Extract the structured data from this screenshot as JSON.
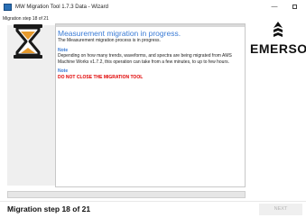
{
  "window": {
    "title": "MW Migration Tool 1.7.3 Data - Wizard",
    "minimize_glyph": "—",
    "app_icon": "window-app-icon"
  },
  "header": {
    "step_text": "Migration step 18 of 21"
  },
  "content": {
    "heading": "Measurement migration in progress.",
    "intro": "The Measurement migration process is in progress.",
    "note1_label": "Note",
    "note1_text": "Depending on how many trends, waveforms, and spectra are being migrated from AMS Machine Works v1.7.2, this operation can take from a few minutes, to up to few hours.",
    "note2_label": "Note",
    "warning": "DO NOT CLOSE THE MIGRATION TOOL"
  },
  "logo": {
    "text": "EMERSON",
    "icon": "emerson-logo-mark"
  },
  "left_panel": {
    "icon": "hourglass-icon",
    "icon_color": "#1a1a1a",
    "sand_color": "#e69a2e"
  },
  "progress": {
    "value": 0
  },
  "footer": {
    "step_text": "Migration step 18 of 21",
    "next_label": "NEXT"
  },
  "colors": {
    "accent": "#3a7bd5",
    "warning": "#e00000",
    "progress_fill": "#06b025"
  }
}
